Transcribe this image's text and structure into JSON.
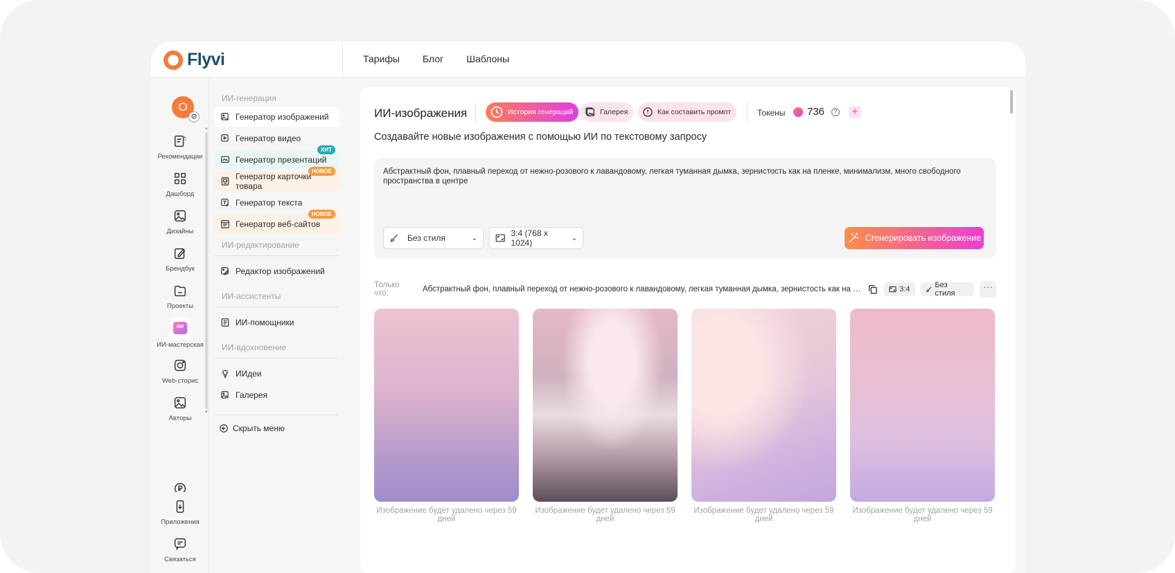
{
  "header": {
    "logo": "Flyvi",
    "nav": [
      "Тарифы",
      "Блог",
      "Шаблоны"
    ]
  },
  "rail": {
    "avatar_letter": "О",
    "items": [
      {
        "label": "Рекомендации",
        "icon": "recommendations-icon"
      },
      {
        "label": "Дашборд",
        "icon": "dashboard-icon"
      },
      {
        "label": "Дизайны",
        "icon": "designs-icon"
      },
      {
        "label": "Брендбук",
        "icon": "brandbook-icon"
      },
      {
        "label": "Проекты",
        "icon": "folder-icon"
      },
      {
        "label": "ИИ-мастерская",
        "icon": "ai-studio-icon",
        "badge": "ИИ"
      },
      {
        "label": "Web-сторис",
        "icon": "stories-icon"
      },
      {
        "label": "Авторы",
        "icon": "authors-icon"
      },
      {
        "label": "Приложения",
        "icon": "apps-icon"
      },
      {
        "label": "Связаться",
        "icon": "chat-icon"
      }
    ]
  },
  "submenu": {
    "sections": {
      "generation": "ИИ-генерация",
      "editing": "ИИ-редактирование",
      "assistants": "ИИ-ассистенты",
      "inspiration": "ИИ-вдохновение"
    },
    "items": {
      "image_gen": "Генератор изображений",
      "video_gen": "Генератор видео",
      "presentation_gen": "Генератор презентаций",
      "card_gen": "Генератор карточки товара",
      "text_gen": "Генератор текста",
      "site_gen": "Генератор веб-сайтов",
      "image_editor": "Редактор изображений",
      "assistants": "ИИ-помощники",
      "ideas": "ИИдеи",
      "gallery": "Галерея",
      "hide_menu": "Скрыть меню"
    },
    "badges": {
      "hit": "ХИТ",
      "new": "НОВОЕ"
    }
  },
  "main": {
    "title": "ИИ-изображения",
    "chips": {
      "history": "История генераций",
      "gallery": "Галерея",
      "prompt": "Как составить промпт"
    },
    "tokens_label": "Токены",
    "tokens_count": "736",
    "help": "?",
    "plus": "+",
    "subtitle": "Создавайте новые изображения с помощью ИИ по текстовому запросу",
    "prompt": "Абстрактный фон, плавный переход от нежно-розового к лавандовому, легкая туманная дымка, зернистость как на пленке, минимализм, много свободного пространства в центре",
    "style_select": "Без стиля",
    "ratio_select": "3:4 (768 x 1024)",
    "generate_button": "Сгенерировать изображение",
    "result": {
      "just_now": "Только что:",
      "prompt": "Абстрактный фон, плавный переход от нежно-розового к лавандовому, легкая туманная дымка, зернистость как на пленке, минимализм, много свободного пространства в центре",
      "ratio_tag": "3:4",
      "style_tag": "Без стиля",
      "more": "···"
    },
    "expire_note": "Изображение будет удалено через 59 дней",
    "colors": {
      "accent_start": "#ff7a59",
      "accent_end": "#e13fe0",
      "brand": "#f57b3a"
    }
  }
}
